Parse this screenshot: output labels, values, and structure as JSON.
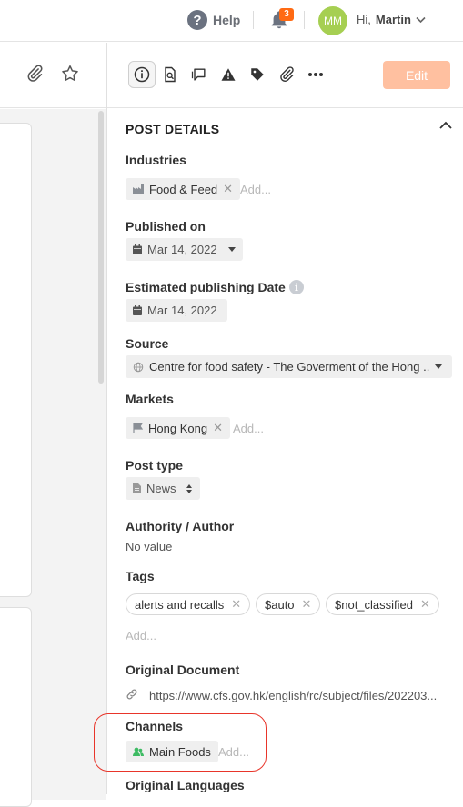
{
  "topbar": {
    "help_label": "Help",
    "help_icon": "?",
    "notifications_count": "3",
    "avatar_initials": "MM",
    "greeting": "Hi,",
    "user_name": "Martin"
  },
  "toolbar": {
    "edit_label": "Edit"
  },
  "post_details": {
    "title": "POST DETAILS",
    "industries_label": "Industries",
    "industries": [
      {
        "label": "Food & Feed"
      }
    ],
    "industries_add": "Add...",
    "published_label": "Published on",
    "published_value": "Mar 14, 2022",
    "estimated_label": "Estimated publishing Date",
    "estimated_value": "Mar 14, 2022",
    "info_glyph": "i",
    "source_label": "Source",
    "source_value": "Centre for food safety - The Goverment of the Hong ...",
    "markets_label": "Markets",
    "markets": [
      {
        "label": "Hong Kong"
      }
    ],
    "markets_add": "Add...",
    "post_type_label": "Post type",
    "post_type_value": "News",
    "author_label": "Authority / Author",
    "author_value": "No value",
    "tags_label": "Tags",
    "tags": [
      {
        "label": "alerts and recalls"
      },
      {
        "label": "$auto"
      },
      {
        "label": "$not_classified"
      }
    ],
    "tags_add": "Add...",
    "original_doc_label": "Original Document",
    "original_doc_url": "https://www.cfs.gov.hk/english/rc/subject/files/202203...",
    "channels_label": "Channels",
    "channels": [
      {
        "label": "Main Foods"
      }
    ],
    "channels_add": "Add...",
    "languages_label": "Original Languages"
  },
  "colors": {
    "accent": "#ff6a13",
    "edit_button": "#ffc0a0",
    "avatar": "#a6cf52",
    "channel_icon": "#3dbb63",
    "highlight_ring": "#e8352a"
  }
}
